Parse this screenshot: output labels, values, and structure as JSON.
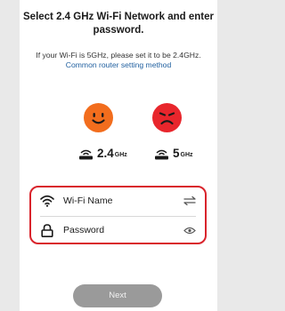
{
  "page": {
    "title": "Select 2.4 GHz Wi-Fi Network and enter password.",
    "note_text": "If your Wi-Fi is 5GHz, please set it to be 2.4GHz.",
    "note_link": "Common router setting method"
  },
  "bands": [
    {
      "value": "2.4",
      "unit": "GHz",
      "status": "supported",
      "face_color": "#f26d1d"
    },
    {
      "value": "5",
      "unit": "GHz",
      "status": "unsupported",
      "face_color": "#e8262c"
    }
  ],
  "form": {
    "wifi_label": "Wi-Fi Name",
    "wifi_icon": "wifi-icon",
    "switch_icon": "switch-network-icon",
    "password_label": "Password",
    "password_icon": "lock-icon",
    "visibility_icon": "eye-icon",
    "highlight_color": "#d9242c"
  },
  "actions": {
    "next_label": "Next"
  }
}
